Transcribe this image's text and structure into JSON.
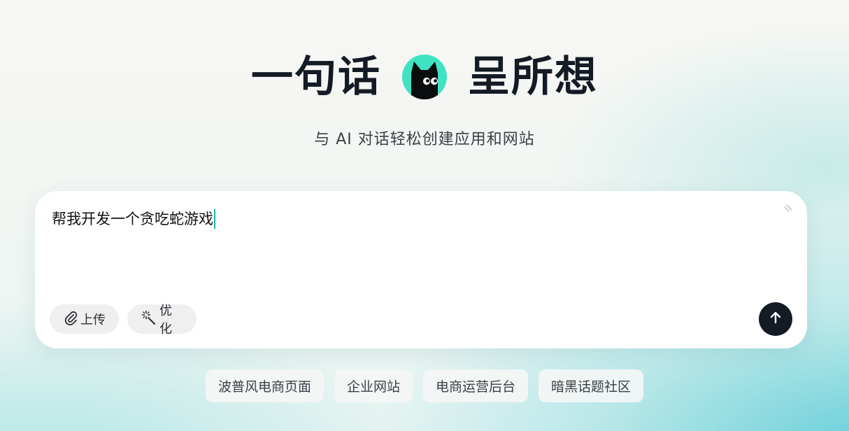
{
  "hero": {
    "title_left": "一句话",
    "title_right": "呈所想",
    "logo_icon": "black-cat-icon",
    "logo_bg": "#3fe3c3",
    "subtitle": "与 AI 对话轻松创建应用和网站"
  },
  "composer": {
    "prompt_value": "帮我开发一个贪吃蛇游戏",
    "upload_label": "上传",
    "upload_icon": "paperclip-icon",
    "optimize_label": "优化",
    "optimize_icon": "magic-wand-icon",
    "send_icon": "arrow-up-icon",
    "send_bg": "#141b25",
    "caret_color": "#13b6b6"
  },
  "suggestions": [
    {
      "label": "波普风电商页面"
    },
    {
      "label": "企业网站"
    },
    {
      "label": "电商运营后台"
    },
    {
      "label": "暗黑话题社区"
    }
  ]
}
